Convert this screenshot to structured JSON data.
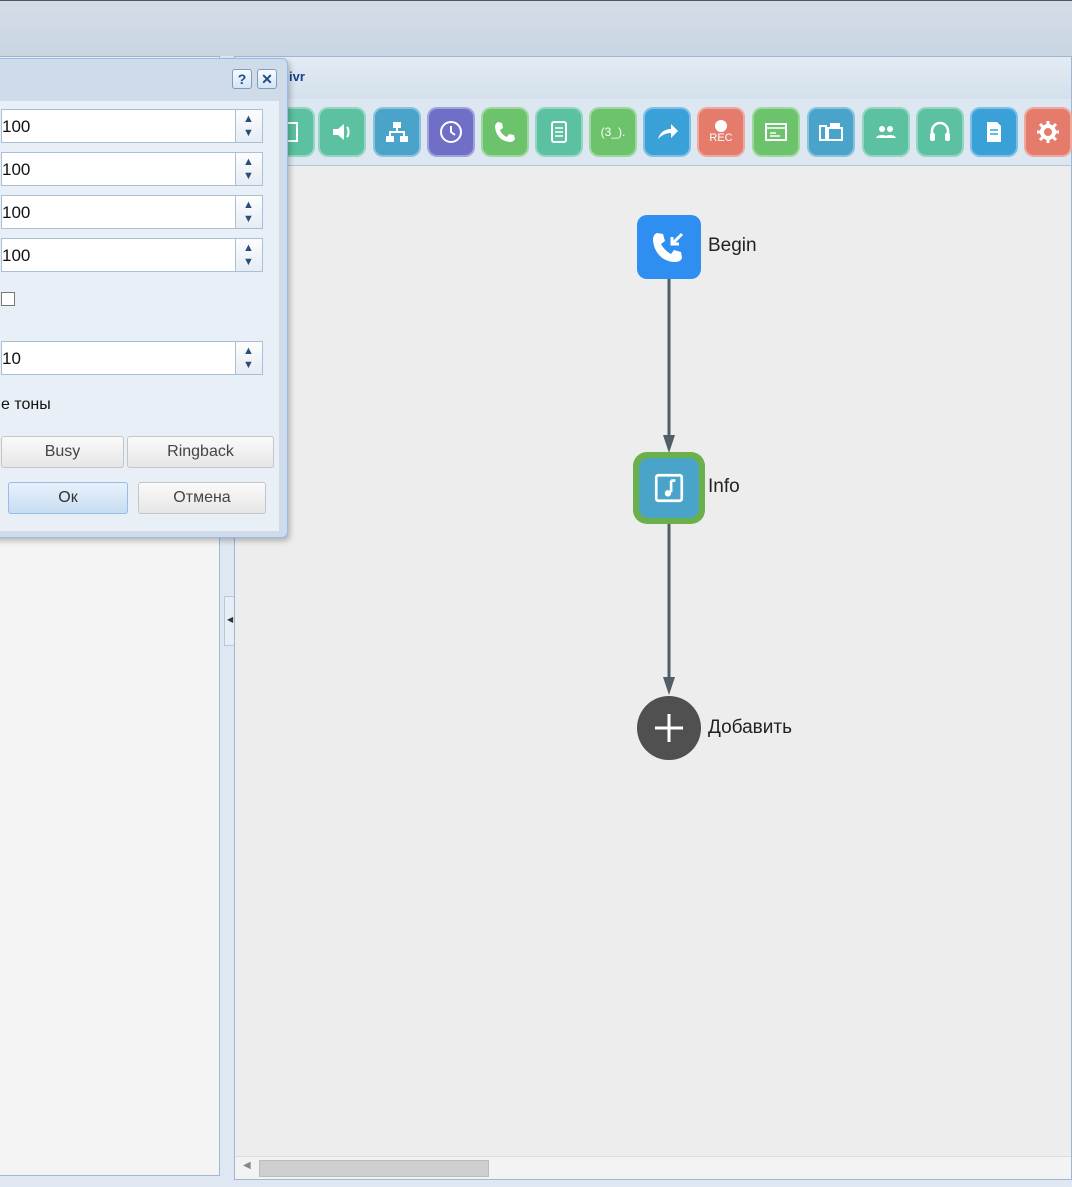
{
  "header": {
    "title": "ivr"
  },
  "toolbar": {
    "items": [
      {
        "name": "document",
        "color": "#5bc1a0"
      },
      {
        "name": "speaker",
        "color": "#5bc1a0"
      },
      {
        "name": "network",
        "color": "#4aa3c8"
      },
      {
        "name": "clock",
        "color": "#6f6fc8"
      },
      {
        "name": "phone",
        "color": "#6cc36c"
      },
      {
        "name": "contacts",
        "color": "#5bc1a0"
      },
      {
        "name": "ellipsis",
        "color": "#6cc36c",
        "label": "(3_)."
      },
      {
        "name": "forward",
        "color": "#3aa0d8"
      },
      {
        "name": "record",
        "color": "#e57b6b",
        "label": "REC"
      },
      {
        "name": "card",
        "color": "#6cc36c"
      },
      {
        "name": "fax",
        "color": "#4aa3c8"
      },
      {
        "name": "group",
        "color": "#5bc1a0"
      },
      {
        "name": "headset",
        "color": "#5bc1a0"
      },
      {
        "name": "script",
        "color": "#3aa0d8"
      },
      {
        "name": "settings",
        "color": "#e57b6b"
      }
    ]
  },
  "flow": {
    "begin_label": "Begin",
    "info_label": "Info",
    "add_label": "Добавить"
  },
  "dialog": {
    "help_label": "?",
    "close_label": "✕",
    "fields": [
      "100",
      "100",
      "100",
      "100"
    ],
    "checkbox_checked": false,
    "timeout_value": "10",
    "tones_label": "е тоны",
    "busy_label": "Busy",
    "ringback_label": "Ringback",
    "ok_label": "Ок",
    "cancel_label": "Отмена"
  }
}
